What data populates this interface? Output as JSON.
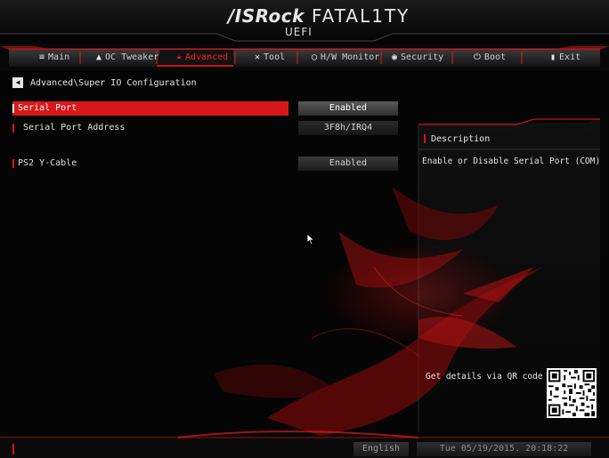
{
  "header": {
    "brand": "/ISRock",
    "product": "FATAL1TY",
    "subtitle": "UEFI"
  },
  "tabs": [
    {
      "label": "Main",
      "icon": "menu-icon",
      "glyph": "≡"
    },
    {
      "label": "OC Tweaker",
      "icon": "tweaker-icon",
      "glyph": "▲"
    },
    {
      "label": "Advanced",
      "icon": "star-icon",
      "glyph": "★"
    },
    {
      "label": "Tool",
      "icon": "tool-icon",
      "glyph": "✕"
    },
    {
      "label": "H/W Monitor",
      "icon": "monitor-icon",
      "glyph": "◯"
    },
    {
      "label": "Security",
      "icon": "shield-icon",
      "glyph": "◉"
    },
    {
      "label": "Boot",
      "icon": "power-icon",
      "glyph": "⏻"
    },
    {
      "label": "Exit",
      "icon": "exit-icon",
      "glyph": "▮"
    }
  ],
  "active_tab": "Advanced",
  "breadcrumb": {
    "back_glyph": "◀",
    "path": "Advanced\\Super IO Configuration"
  },
  "settings": [
    {
      "label": "Serial Port",
      "value": "Enabled",
      "selected": true
    },
    {
      "label": "Serial Port Address",
      "value": "3F8h/IRQ4",
      "selected": false
    },
    {
      "label": "PS2 Y-Cable",
      "value": "Enabled",
      "selected": false
    }
  ],
  "description": {
    "title": "Description",
    "text": "Enable or Disable Serial Port (COM)"
  },
  "qr": {
    "label": "Get details via QR code"
  },
  "footer": {
    "language": "English",
    "datetime": "Tue 05/19/2015. 20:18:22"
  },
  "colors": {
    "accent": "#d81818",
    "background": "#050505"
  }
}
